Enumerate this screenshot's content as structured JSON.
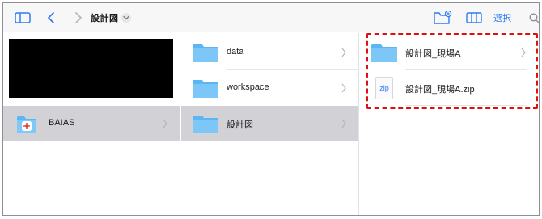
{
  "toolbar": {
    "title": "設計図",
    "select_label": "選択"
  },
  "column1": {
    "items": [
      {
        "label": "BAIAS",
        "icon": "baias-app-icon"
      }
    ]
  },
  "column2": {
    "items": [
      {
        "label": "data",
        "icon": "folder-icon"
      },
      {
        "label": "workspace",
        "icon": "folder-icon"
      },
      {
        "label": "設計図",
        "icon": "folder-icon"
      }
    ]
  },
  "column3": {
    "items": [
      {
        "label": "設計図_現場A",
        "icon": "folder-icon"
      },
      {
        "label": "設計図_現場A.zip",
        "icon": "zip-file-icon",
        "badge": "zip"
      }
    ]
  },
  "colors": {
    "accent": "#2f7cf6",
    "folder": "#5ab6f5",
    "selection": "#d1d1d6",
    "highlight": "#e01010"
  }
}
